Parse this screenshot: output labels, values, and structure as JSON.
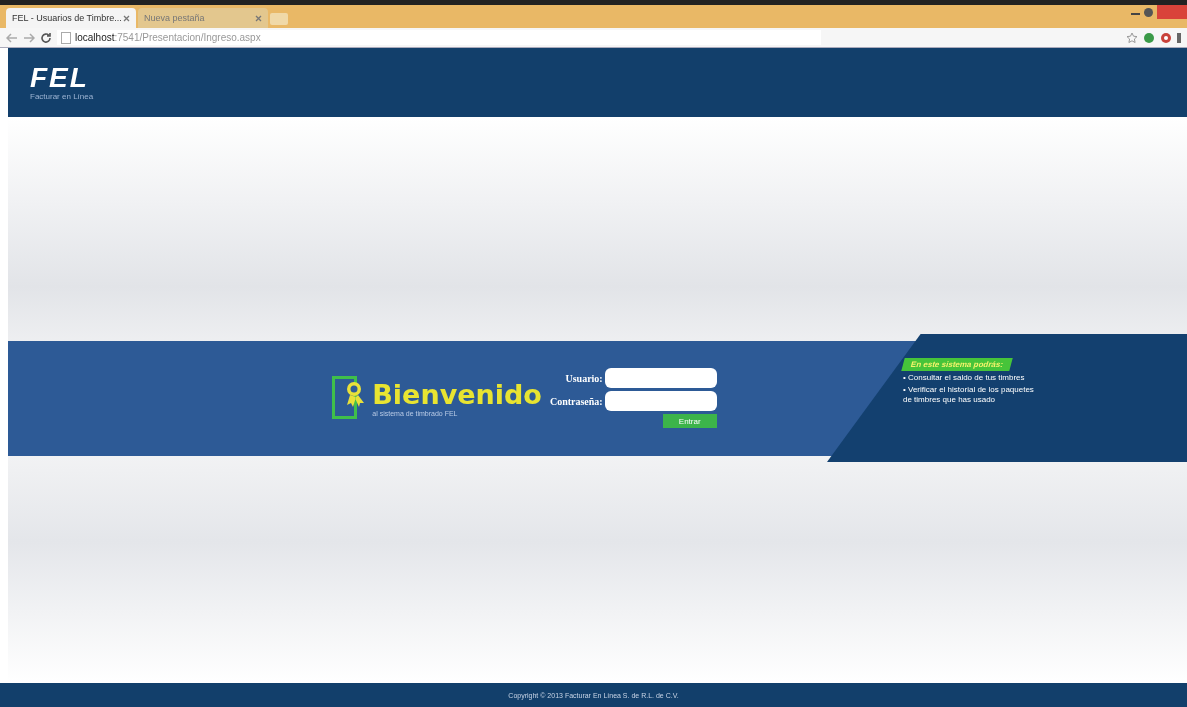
{
  "browser": {
    "tabs": [
      {
        "label": "FEL - Usuarios de Timbre...",
        "selected": true
      },
      {
        "label": "Nueva pestaña",
        "selected": false
      }
    ],
    "address": {
      "host": "localhost",
      "path": ":7541/Presentacion/Ingreso.aspx"
    }
  },
  "header": {
    "logo": "FEL",
    "tagline": "Facturar en Línea"
  },
  "welcome": {
    "title": "Bienvenido",
    "subtitle": "al sistema de timbrado FEL"
  },
  "login": {
    "fields": [
      {
        "label": "Usuario:"
      },
      {
        "label": "Contraseña:"
      }
    ],
    "button": "Entrar"
  },
  "info": {
    "heading": "En este sistema podrás:",
    "items": [
      "• Consultar el saldo de tus timbres",
      "• Verificar el historial de los paquetes de timbres que has usado"
    ]
  },
  "footer": "Copyright © 2013 Facturar En Línea S. de R.L. de C.V."
}
